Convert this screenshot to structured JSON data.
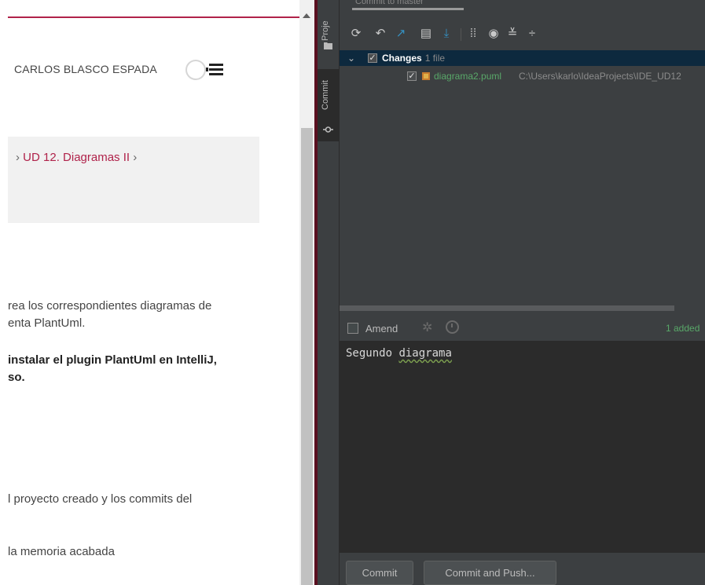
{
  "browser": {
    "user_name": "CARLOS BLASCO ESPADA",
    "breadcrumb_prefix": "›",
    "breadcrumb_link": "UD 12. Diagramas II",
    "breadcrumb_suffix": "›",
    "paragraphs": [
      "rea los correspondientes diagramas de",
      "enta PlantUml.",
      "instalar el plugin PlantUml en IntelliJ,",
      "so.",
      "l proyecto creado y los commits del",
      "la memoria acabada"
    ]
  },
  "ide": {
    "vertical_tabs": {
      "project": "Proje",
      "commit": "Commit"
    },
    "panel_title": "Commit to master",
    "toolbar_icons": [
      "refresh-icon",
      "rollback-icon",
      "diff-icon",
      "shelve-icon",
      "update-icon",
      "group-by-icon",
      "preview-icon",
      "expand-all-icon",
      "collapse-all-icon"
    ],
    "changes": {
      "label": "Changes",
      "count": "1 file",
      "file_name": "diagrama2.puml",
      "file_path": "C:\\Users\\karlo\\IdeaProjects\\IDE_UD12"
    },
    "amend_label": "Amend",
    "status": "1 added",
    "commit_message_word1": "Segundo",
    "commit_message_word2": "diagrama",
    "buttons": {
      "commit": "Commit",
      "commit_and_push": "Commit and Push..."
    },
    "colors": {
      "accent_red": "#b0224a",
      "added_green": "#59a869",
      "selection_blue": "#0d293e"
    }
  }
}
